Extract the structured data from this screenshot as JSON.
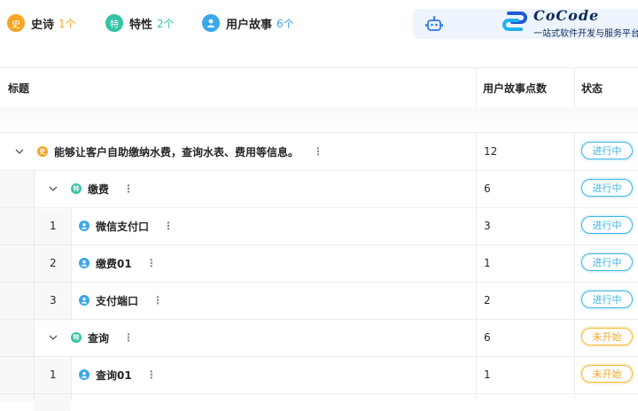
{
  "summary": [
    {
      "label": "史诗",
      "count": "1个",
      "badge": "史",
      "color": "#f5a623",
      "countColor": "#f5a623"
    },
    {
      "label": "特性",
      "count": "2个",
      "badge": "特",
      "color": "#34c3a4",
      "countColor": "#34c3a4"
    },
    {
      "label": "用户故事",
      "count": "6个",
      "badge": "user-icon",
      "color": "#3aa8e8",
      "countColor": "#3aa8e8"
    }
  ],
  "brand": {
    "title": "CoCode",
    "subtitle": "一站式软件开发与服务平台"
  },
  "table": {
    "headers": {
      "title": "标题",
      "points": "用户故事点数",
      "status": "状态"
    },
    "rows": [
      {
        "level": "epic",
        "index": "",
        "title": "能够让客户自助缴纳水费，查询水表、费用等信息。",
        "points": "12",
        "status": "进行中",
        "statusType": "progress"
      },
      {
        "level": "feature",
        "index": "",
        "title": "缴费",
        "points": "6",
        "status": "进行中",
        "statusType": "progress"
      },
      {
        "level": "story",
        "index": "1",
        "title": "微信支付口",
        "points": "3",
        "status": "进行中",
        "statusType": "progress"
      },
      {
        "level": "story",
        "index": "2",
        "title": "缴费01",
        "points": "1",
        "status": "进行中",
        "statusType": "progress"
      },
      {
        "level": "story",
        "index": "3",
        "title": "支付端口",
        "points": "2",
        "status": "进行中",
        "statusType": "progress"
      },
      {
        "level": "feature",
        "index": "",
        "title": "查询",
        "points": "6",
        "status": "未开始",
        "statusType": "todo"
      },
      {
        "level": "story",
        "index": "1",
        "title": "查询01",
        "points": "1",
        "status": "未开始",
        "statusType": "todo"
      }
    ]
  },
  "icons": {
    "more": "⋮",
    "epic_badge": "史",
    "feature_badge": "特"
  }
}
